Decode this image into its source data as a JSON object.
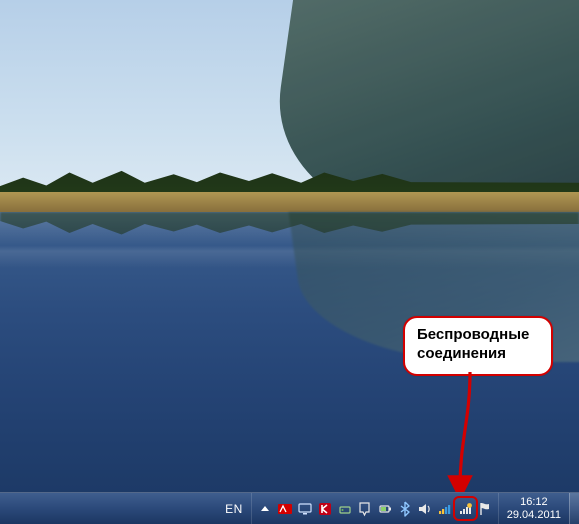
{
  "callout": {
    "line1": "Беспроводные",
    "line2": "соединения"
  },
  "taskbar": {
    "language_indicator": "EN",
    "clock": {
      "time": "16:12",
      "date": "29.04.2011"
    },
    "tray_icons": [
      {
        "name": "show-hidden-icons-icon"
      },
      {
        "name": "nvidia-icon"
      },
      {
        "name": "monitor-icon"
      },
      {
        "name": "kaspersky-icon"
      },
      {
        "name": "safely-remove-hardware-icon"
      },
      {
        "name": "action-center-icon"
      },
      {
        "name": "power-icon"
      },
      {
        "name": "bluetooth-icon"
      },
      {
        "name": "volume-icon"
      },
      {
        "name": "network-colored-icon"
      },
      {
        "name": "network-wireless-icon"
      },
      {
        "name": "flag-icon"
      }
    ]
  },
  "colors": {
    "highlight": "#d30000",
    "taskbar_top": "#3f5e8e",
    "taskbar_bottom": "#1b3662"
  }
}
